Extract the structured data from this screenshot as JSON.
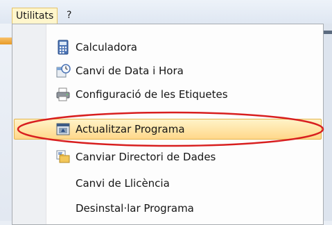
{
  "menubar": {
    "items": [
      {
        "label": "Utilitats"
      },
      {
        "label": "?"
      }
    ]
  },
  "dropdown": {
    "items": [
      {
        "label": "Calculadora",
        "icon": "calculator-icon"
      },
      {
        "label": "Canvi de Data i Hora",
        "icon": "clock-icon"
      },
      {
        "label": "Configuració de les Etiquetes",
        "icon": "label-printer-icon"
      },
      {
        "label": "Actualitzar Programa",
        "icon": "update-icon",
        "highlighted": true
      },
      {
        "label": "Canviar Directori de Dades",
        "icon": "folder-swap-icon"
      },
      {
        "label": "Canvi de Llicència",
        "icon": ""
      },
      {
        "label": "Desinstal·lar Programa",
        "icon": ""
      }
    ]
  },
  "colors": {
    "highlight": "#ffd88a",
    "annotation": "#d81f1f",
    "menu_border": "#a7abb0"
  }
}
